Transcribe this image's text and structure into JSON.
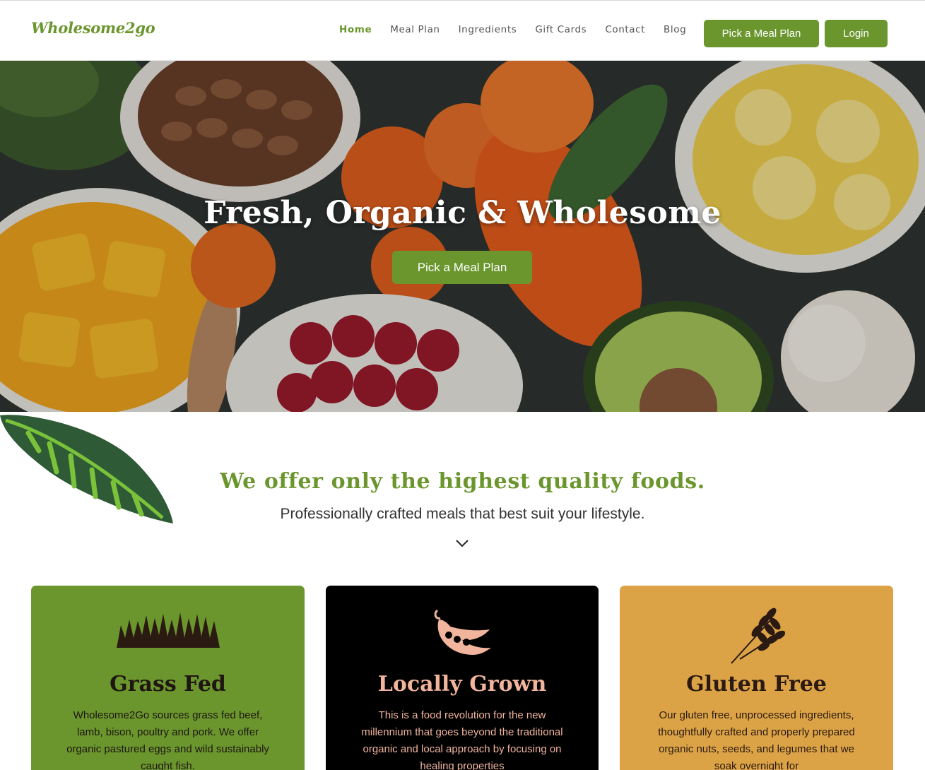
{
  "brand": {
    "logo_text": "Wholesome2go"
  },
  "nav": {
    "items": [
      {
        "label": "Home",
        "active": true
      },
      {
        "label": "Meal Plan"
      },
      {
        "label": "Ingredients"
      },
      {
        "label": "Gift Cards"
      },
      {
        "label": "Contact"
      },
      {
        "label": "Blog"
      }
    ]
  },
  "header": {
    "cta_label": "Pick a Meal Plan",
    "login_label": "Login"
  },
  "hero": {
    "title": "Fresh, Organic & Wholesome",
    "cta_label": "Pick a Meal Plan"
  },
  "intro": {
    "title": "We offer only the highest quality foods.",
    "subtitle": "Professionally crafted meals that best suit your lifestyle."
  },
  "cards": [
    {
      "title": "Grass Fed",
      "text": "Wholesome2Go sources grass fed beef, lamb, bison, poultry and pork. We offer organic pastured eggs and wild sustainably caught fish.",
      "icon": "grass-icon"
    },
    {
      "title": "Locally Grown",
      "text": "This is a food revolution for the new millennium that goes beyond the traditional organic and local approach by focusing on healing properties",
      "icon": "pea-pod-icon"
    },
    {
      "title": "Gluten Free",
      "text": "Our gluten free, unprocessed ingredients, thoughtfully crafted and properly prepared organic nuts, seeds, and legumes that we soak overnight for",
      "icon": "wheat-icon"
    }
  ],
  "colors": {
    "brand_green": "#6a962d",
    "card_black": "#000000",
    "card_mustard": "#dca346",
    "card_pink_text": "#f1b49c"
  }
}
